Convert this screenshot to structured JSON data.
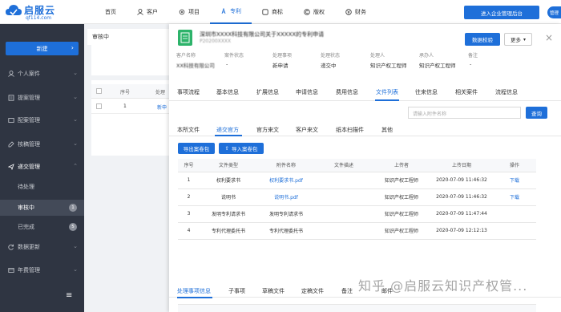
{
  "header": {
    "logo_name": "启服云",
    "logo_url": "qf114.com",
    "nav": [
      {
        "label": "首页",
        "icon": "none"
      },
      {
        "label": "客户",
        "icon": "user-icon"
      },
      {
        "label": "项目",
        "icon": "gear-icon"
      },
      {
        "label": "专利",
        "icon": "patent-icon",
        "active": true
      },
      {
        "label": "商标",
        "icon": "trademark-icon"
      },
      {
        "label": "版权",
        "icon": "copyright-icon"
      },
      {
        "label": "财务",
        "icon": "finance-icon"
      }
    ],
    "enter_button": "进入企业管理后台",
    "avatar": "管理"
  },
  "sidebar": {
    "new_button": "新建",
    "items": [
      {
        "label": "个人案件",
        "icon": "person-icon"
      },
      {
        "label": "提案管理",
        "icon": "proposal-icon"
      },
      {
        "label": "配案管理",
        "icon": "assign-icon"
      },
      {
        "label": "核稿管理",
        "icon": "review-icon"
      },
      {
        "label": "递交管理",
        "icon": "submit-icon"
      }
    ],
    "sub_items": [
      {
        "label": "待处理",
        "badge": ""
      },
      {
        "label": "审核中",
        "badge": "1"
      },
      {
        "label": "已完成",
        "badge": "5"
      }
    ],
    "bottom_items": [
      {
        "label": "数据更新",
        "icon": "refresh-icon"
      },
      {
        "label": "年费管理",
        "icon": "fee-icon"
      }
    ]
  },
  "background_list": {
    "tab_label": "审核中",
    "col_index": "序号",
    "col_process": "处理",
    "row_index": "1",
    "row_value": "新申"
  },
  "detail": {
    "title": "深圳市XXXX科技有限公司关于XXXXX的专利申请",
    "subtitle": "P20200XXXX",
    "check_button": "数据校验",
    "more_button": "更多",
    "info": [
      {
        "label": "客户名称",
        "value": "XX科技有限公司"
      },
      {
        "label": "案件状态",
        "value": "-"
      },
      {
        "label": "处理事项",
        "value": "新申请"
      },
      {
        "label": "处理状态",
        "value": "递交中"
      },
      {
        "label": "处理人",
        "value": "知识产权工程师"
      },
      {
        "label": "承办人",
        "value": "知识产权工程师"
      },
      {
        "label": "备注",
        "value": "-"
      }
    ],
    "tabs": [
      "事项流程",
      "基本信息",
      "扩展信息",
      "申请信息",
      "费用信息",
      "文件列表",
      "往来信息",
      "相关案件",
      "流程信息"
    ],
    "active_tab": "文件列表",
    "search_placeholder": "请输入附件名称",
    "search_button": "查询",
    "file_tabs": [
      "本所文件",
      "递交官方",
      "官方来文",
      "客户来文",
      "纸本扫描件",
      "其他"
    ],
    "active_file_tab": "递交官方",
    "export_button": "导出案卷包",
    "import_button": "导入案卷包",
    "table_headers": [
      "序号",
      "文件类型",
      "附件名称",
      "文件描述",
      "上传者",
      "上传日期",
      "操作"
    ],
    "rows": [
      {
        "index": "1",
        "type": "权利要求书",
        "name": "权利要求书.pdf",
        "desc": "",
        "uploader": "知识产权工程师",
        "date": "2020-07-09 11:46:32",
        "action": "下载"
      },
      {
        "index": "2",
        "type": "说明书",
        "name": "说明书.pdf",
        "desc": "",
        "uploader": "知识产权工程师",
        "date": "2020-07-09 11:46:32",
        "action": "下载"
      },
      {
        "index": "3",
        "type": "发明专利请求书",
        "name": "发明专利请求书",
        "desc": "",
        "uploader": "知识产权工程师",
        "date": "2020-07-09 11:47:44",
        "action": ""
      },
      {
        "index": "4",
        "type": "专利代理委托书",
        "name": "专利代理委托书",
        "desc": "",
        "uploader": "知识产权工程师",
        "date": "2020-07-09 12:12:13",
        "action": ""
      }
    ],
    "bottom_tabs": [
      "处理事项信息",
      "子事项",
      "草稿文件",
      "定稿文件",
      "备注",
      "邮件"
    ],
    "active_bottom_tab": "处理事项信息"
  },
  "watermark": "知乎 @启服云知识产权管...",
  "colors": {
    "accent": "#1e6fd9",
    "sidebar": "#2f3542",
    "logo_green": "#2db36a"
  }
}
